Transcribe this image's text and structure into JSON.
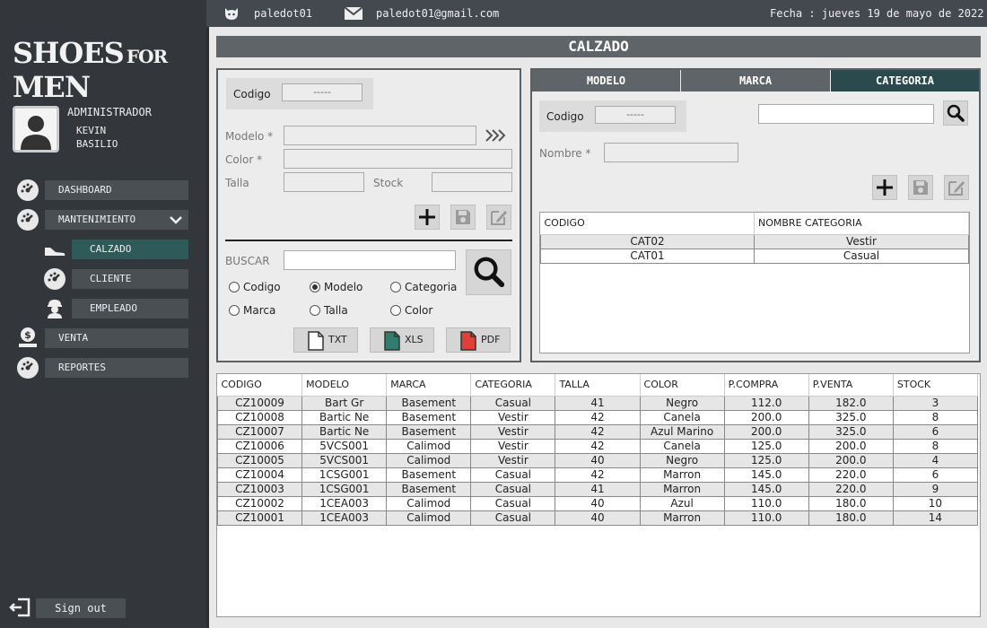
{
  "app": {
    "logo_big1": "SHOES",
    "logo_small": "FOR",
    "logo_big2": "MEN",
    "role": "ADMINISTRADOR",
    "user_first": "KEVIN",
    "user_last": "BASILIO"
  },
  "topbar": {
    "username": "paledot01",
    "email": "paledot01@gmail.com",
    "date": "Fecha : jueves 19 de mayo de 2022"
  },
  "nav": {
    "dashboard": "DASHBOARD",
    "mantenimiento": "MANTENIMIENTO",
    "calzado": "CALZADO",
    "cliente": "CLIENTE",
    "empleado": "EMPLEADO",
    "venta": "VENTA",
    "reportes": "REPORTES",
    "signout": "Sign out"
  },
  "page": {
    "title": "CALZADO"
  },
  "form": {
    "codigo_label": "Codigo",
    "codigo_value": "-----",
    "modelo_label": "Modelo *",
    "color_label": "Color *",
    "talla_label": "Talla",
    "stock_label": "Stock",
    "buscar_label": "BUSCAR",
    "radios": {
      "codigo": "Codigo",
      "modelo": "Modelo",
      "categoria": "Categoria",
      "marca": "Marca",
      "talla": "Talla",
      "color": "Color"
    },
    "selected_radio": "modelo",
    "exports": {
      "txt": "TXT",
      "xls": "XLS",
      "pdf": "PDF"
    }
  },
  "tabs": {
    "modelo": "MODELO",
    "marca": "MARCA",
    "categoria": "CATEGORIA",
    "active": "categoria"
  },
  "cat_form": {
    "codigo_label": "Codigo",
    "codigo_value": "-----",
    "nombre_label": "Nombre *",
    "search_value": ""
  },
  "cat_table": {
    "headers": [
      "CODIGO",
      "NOMBRE CATEGORIA"
    ],
    "rows": [
      [
        "CAT02",
        "Vestir"
      ],
      [
        "CAT01",
        "Casual"
      ]
    ]
  },
  "main_table": {
    "headers": [
      "CODIGO",
      "MODELO",
      "MARCA",
      "CATEGORIA",
      "TALLA",
      "COLOR",
      "P.COMPRA",
      "P.VENTA",
      "STOCK"
    ],
    "rows": [
      [
        "CZ10009",
        "Bart Gr",
        "Basement",
        "Casual",
        "41",
        "Negro",
        "112.0",
        "182.0",
        "3"
      ],
      [
        "CZ10008",
        "Bartic Ne",
        "Basement",
        "Vestir",
        "42",
        "Canela",
        "200.0",
        "325.0",
        "8"
      ],
      [
        "CZ10007",
        "Bartic Ne",
        "Basement",
        "Vestir",
        "42",
        "Azul Marino",
        "200.0",
        "325.0",
        "6"
      ],
      [
        "CZ10006",
        "5VCS001",
        "Calimod",
        "Vestir",
        "42",
        "Canela",
        "125.0",
        "200.0",
        "8"
      ],
      [
        "CZ10005",
        "5VCS001",
        "Calimod",
        "Vestir",
        "40",
        "Negro",
        "125.0",
        "200.0",
        "4"
      ],
      [
        "CZ10004",
        "1CSG001",
        "Basement",
        "Casual",
        "42",
        "Marron",
        "145.0",
        "220.0",
        "6"
      ],
      [
        "CZ10003",
        "1CSG001",
        "Basement",
        "Casual",
        "41",
        "Marron",
        "145.0",
        "220.0",
        "9"
      ],
      [
        "CZ10002",
        "1CEA003",
        "Calimod",
        "Casual",
        "40",
        "Azul",
        "110.0",
        "180.0",
        "10"
      ],
      [
        "CZ10001",
        "1CEA003",
        "Calimod",
        "Casual",
        "40",
        "Marron",
        "110.0",
        "180.0",
        "14"
      ]
    ]
  },
  "colors": {
    "sidebar": "#33373b",
    "nav_button": "#4a4f54",
    "active_teal": "#2f5a5a",
    "title_bar": "#5f6468"
  }
}
